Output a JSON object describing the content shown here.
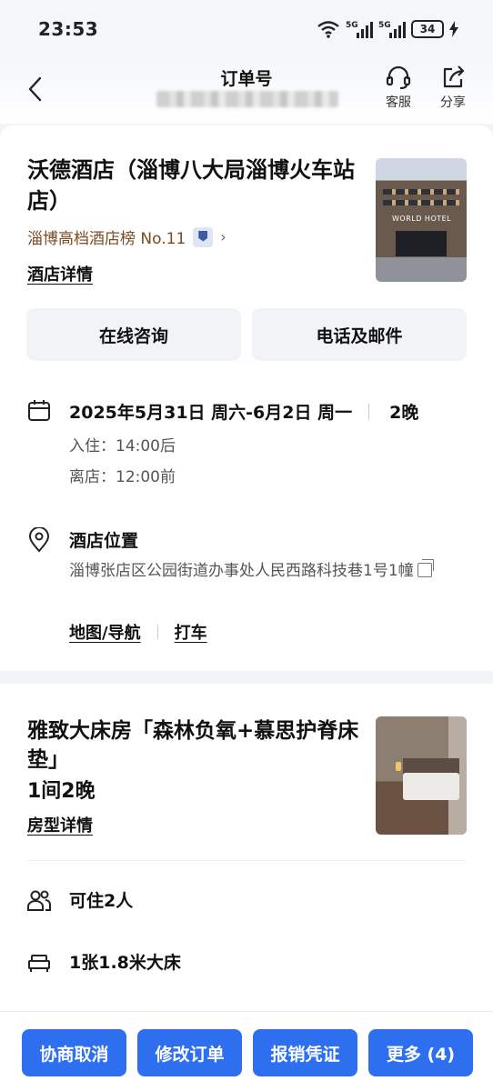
{
  "status_bar": {
    "time": "23:53",
    "network_1": "5G",
    "network_2": "5G",
    "battery": "34",
    "icons": [
      "wifi-icon",
      "signal-icon",
      "signal-icon",
      "battery-icon",
      "charging-icon"
    ]
  },
  "header": {
    "title": "订单号",
    "service_label": "客服",
    "share_label": "分享",
    "icons": [
      "back-arrow-icon",
      "headset-icon",
      "share-icon"
    ]
  },
  "hotel": {
    "name": "沃德酒店（淄博八大局淄博火车站店）",
    "rank": "淄博高档酒店榜 No.11",
    "rank_chevron": "›",
    "detail_link": "酒店详情",
    "consult_button": "在线咨询",
    "phone_button": "电话及邮件",
    "photo_sign": "WORLD HOTEL"
  },
  "stay": {
    "dates": "2025年5月31日 周六-6月2日 周一",
    "nights": "2晚",
    "checkin": "入住：14:00后",
    "checkout": "离店：12:00前"
  },
  "location": {
    "title": "酒店位置",
    "address": "淄博张店区公园街道办事处人民西路科技巷1号1幢",
    "map_link": "地图/导航",
    "taxi_link": "打车"
  },
  "room": {
    "name": "雅致大床房「森林负氧+慕思护脊床垫」",
    "quantity": "1间2晚",
    "detail_link": "房型详情",
    "occupancy": "可住2人",
    "bed": "1张1.8米大床"
  },
  "actions": {
    "cancel": "协商取消",
    "modify": "修改订单",
    "invoice": "报销凭证",
    "more": "更多 (4)"
  },
  "colors": {
    "primary_blue": "#2e6ff0",
    "rank_brown": "#7a4a22",
    "page_bg": "#f2f4f7"
  }
}
